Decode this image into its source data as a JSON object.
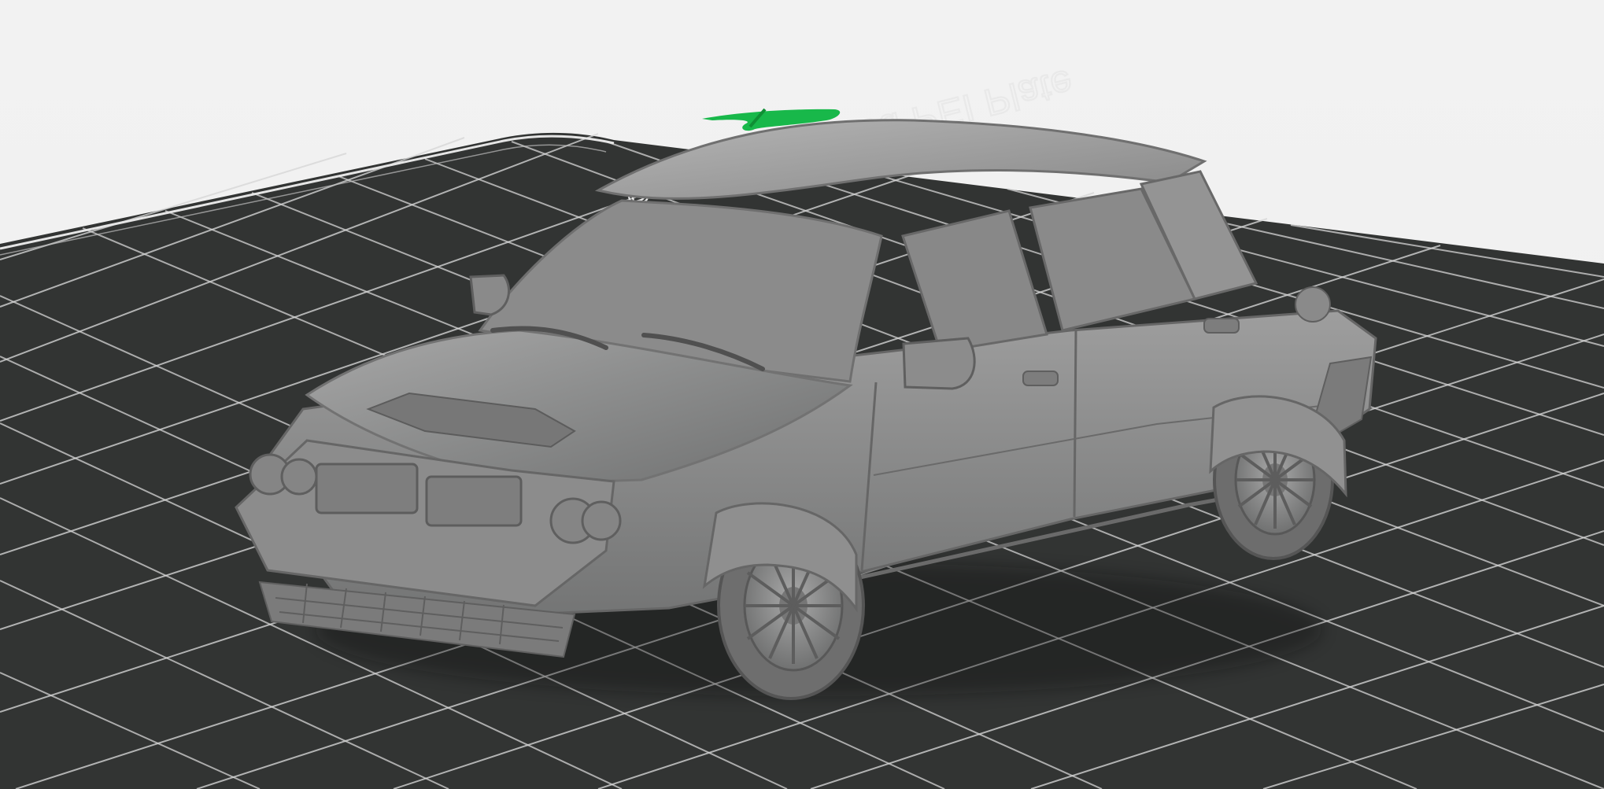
{
  "viewport": {
    "background_color": "#f1f1f1",
    "plate_color": "#323433",
    "grid_line_color": "#d8d8d8",
    "model_color": "#8f9090"
  },
  "build_plate": {
    "label": "Bambu Textured PEI Plate",
    "icons": {
      "origin_marker": "origin-marker-icon"
    },
    "origin_marker_color": "#18b84a"
  },
  "model": {
    "name": "car-3d-model",
    "preview_mode": "solid-gray"
  }
}
